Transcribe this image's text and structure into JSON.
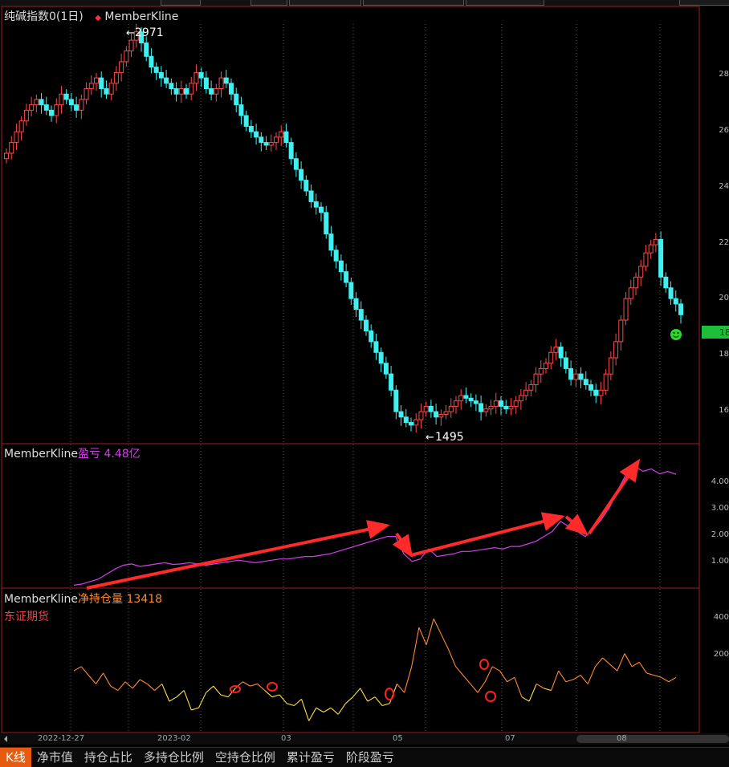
{
  "header": {
    "instrument": "纯碱指数0(1日)",
    "indicator_marker": "◆",
    "indicator": "MemberKline"
  },
  "price_panel": {
    "high_label": "2971",
    "low_label": "1495",
    "last_price_tag": "18",
    "y_ticks": [
      "28",
      "26",
      "24",
      "22",
      "20",
      "18",
      "16"
    ]
  },
  "pnl_panel": {
    "name": "MemberKline",
    "metric": "盈亏",
    "value": "4.48亿",
    "y_ticks": [
      "4.00",
      "3.00",
      "2.00",
      "1.00"
    ]
  },
  "position_panel": {
    "name": "MemberKline",
    "metric": "净持仓量",
    "value": "13418",
    "member": "东证期货",
    "y_ticks": [
      "400",
      "200"
    ]
  },
  "x_axis": {
    "labels": [
      "2022-12-27",
      "2023-02",
      "03",
      "05",
      "07",
      "08"
    ]
  },
  "tabs": [
    "K线",
    "净市值",
    "持仓占比",
    "多持仓比例",
    "空持仓比例",
    "累计盈亏",
    "阶段盈亏"
  ],
  "colors": {
    "up": "#ff4a4a",
    "down": "#3ff0f0",
    "pnl_line": "#d040e8",
    "position_line": "#ff8a30",
    "position_line_low": "#ffe040",
    "arrow": "#ff2a2a",
    "panel_border": "#a02020",
    "active_tab": "#e85b0e",
    "last_price": "#1dbf3a"
  },
  "chart_data": [
    {
      "type": "candlestick",
      "title": "纯碱指数0(1日)",
      "y_unit_display": "hundreds",
      "ylim": [
        1450,
        3000
      ],
      "annotations": [
        {
          "text": "2971",
          "value": 2971
        },
        {
          "text": "1495",
          "value": 1495
        }
      ],
      "close": [
        2520,
        2560,
        2600,
        2640,
        2680,
        2700,
        2720,
        2700,
        2680,
        2660,
        2700,
        2740,
        2720,
        2700,
        2680,
        2720,
        2760,
        2780,
        2800,
        2760,
        2740,
        2780,
        2820,
        2860,
        2900,
        2940,
        2971,
        2930,
        2880,
        2840,
        2820,
        2800,
        2780,
        2760,
        2740,
        2760,
        2740,
        2780,
        2820,
        2800,
        2760,
        2740,
        2760,
        2800,
        2780,
        2740,
        2700,
        2660,
        2620,
        2600,
        2580,
        2560,
        2550,
        2560,
        2580,
        2600,
        2560,
        2500,
        2460,
        2420,
        2380,
        2340,
        2320,
        2300,
        2220,
        2160,
        2120,
        2080,
        2040,
        1980,
        1940,
        1900,
        1860,
        1820,
        1780,
        1740,
        1700,
        1640,
        1560,
        1540,
        1520,
        1510,
        1530,
        1560,
        1580,
        1560,
        1540,
        1550,
        1560,
        1580,
        1600,
        1620,
        1610,
        1600,
        1590,
        1560,
        1570,
        1580,
        1600,
        1580,
        1570,
        1580,
        1600,
        1620,
        1640,
        1660,
        1700,
        1720,
        1740,
        1780,
        1800,
        1760,
        1720,
        1680,
        1700,
        1680,
        1660,
        1640,
        1620,
        1640,
        1700,
        1760,
        1820,
        1900,
        1980,
        2020,
        2060,
        2100,
        2150,
        2180,
        2200,
        2060,
        2020,
        1980,
        1960,
        1920
      ]
    },
    {
      "type": "line",
      "title": "盈亏",
      "unit": "亿",
      "ylim": [
        0.5,
        5.0
      ],
      "values": [
        0.05,
        0.1,
        0.2,
        0.3,
        0.5,
        0.7,
        0.85,
        0.9,
        0.8,
        0.85,
        0.9,
        0.95,
        0.88,
        0.9,
        0.95,
        0.9,
        0.85,
        0.9,
        0.95,
        1.0,
        1.05,
        1.0,
        0.95,
        1.0,
        1.05,
        1.1,
        1.1,
        1.15,
        1.2,
        1.2,
        1.25,
        1.3,
        1.4,
        1.5,
        1.6,
        1.7,
        1.8,
        1.9,
        2.0,
        2.0,
        1.3,
        1.0,
        1.1,
        1.5,
        1.2,
        1.25,
        1.3,
        1.4,
        1.4,
        1.45,
        1.5,
        1.55,
        1.5,
        1.6,
        1.6,
        1.7,
        1.8,
        2.0,
        2.2,
        2.6,
        2.4,
        2.2,
        2.0,
        2.3,
        2.7,
        3.2,
        3.9,
        4.5,
        4.8,
        4.6,
        4.7,
        4.5,
        4.6,
        4.48
      ]
    },
    {
      "type": "line",
      "title": "净持仓量",
      "member": "东证期货",
      "ylim": [
        -100,
        480
      ],
      "values": [
        180,
        200,
        160,
        120,
        170,
        110,
        90,
        130,
        100,
        140,
        120,
        90,
        120,
        40,
        60,
        90,
        0,
        10,
        80,
        110,
        70,
        60,
        100,
        130,
        110,
        120,
        90,
        60,
        70,
        30,
        20,
        50,
        -50,
        10,
        -10,
        10,
        -20,
        30,
        60,
        100,
        40,
        60,
        20,
        30,
        120,
        80,
        200,
        380,
        300,
        420,
        350,
        280,
        200,
        160,
        120,
        80,
        130,
        200,
        180,
        130,
        150,
        60,
        40,
        120,
        100,
        90,
        180,
        130,
        140,
        160,
        120,
        200,
        240,
        210,
        180,
        260,
        200,
        220,
        170,
        160,
        150,
        130,
        150
      ]
    }
  ]
}
